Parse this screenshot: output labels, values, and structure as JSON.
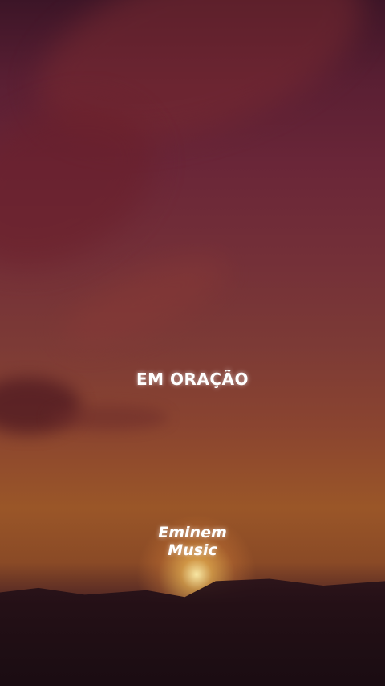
{
  "title": "EM ORAÇÃO",
  "watermark": {
    "line1": "Eminem",
    "line2": "Music"
  },
  "colors": {
    "sky_top": "#3c1527",
    "sky_mid": "#7c3a36",
    "sky_low": "#9a5628",
    "ground": "#1a0c12",
    "text": "#ffffff"
  }
}
